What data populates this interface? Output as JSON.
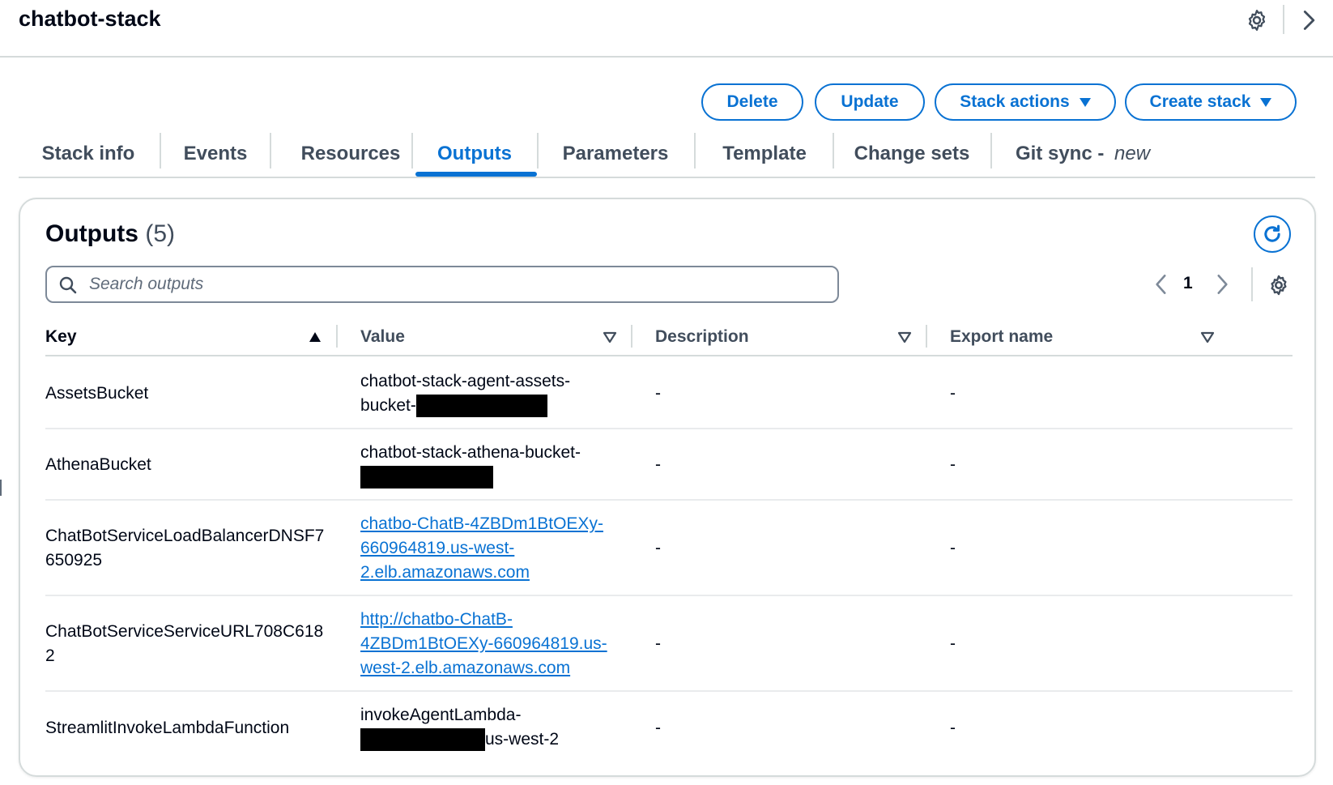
{
  "header": {
    "title": "chatbot-stack"
  },
  "actions": {
    "delete": "Delete",
    "update": "Update",
    "stack_actions": "Stack actions",
    "create_stack": "Create stack"
  },
  "tabs": [
    {
      "label": "Stack info"
    },
    {
      "label": "Events"
    },
    {
      "label": "Resources"
    },
    {
      "label": "Outputs"
    },
    {
      "label": "Parameters"
    },
    {
      "label": "Template"
    },
    {
      "label": "Change sets"
    },
    {
      "label": "Git sync - ",
      "badge": "new"
    }
  ],
  "active_tab": "Outputs",
  "outputs": {
    "title": "Outputs",
    "count": "(5)",
    "search_placeholder": "Search outputs",
    "page": "1",
    "columns": [
      "Key",
      "Value",
      "Description",
      "Export name"
    ],
    "rows": [
      {
        "key": [
          "AssetsBucket"
        ],
        "value": [
          "chatbot-stack-agent-assets-",
          "bucket-"
        ],
        "link": false,
        "description": "-",
        "export": "-"
      },
      {
        "key": [
          "AthenaBucket"
        ],
        "value": [
          "chatbot-stack-athena-bucket-",
          ""
        ],
        "link": false,
        "description": "-",
        "export": "-"
      },
      {
        "key": [
          "ChatBotServiceLoadBalancerDNSF7",
          "650925"
        ],
        "value": [
          "chatbo-ChatB-4ZBDm1BtOEXy-",
          "660964819.us-west-",
          "2.elb.amazonaws.com"
        ],
        "link": true,
        "description": "-",
        "export": "-"
      },
      {
        "key": [
          "ChatBotServiceServiceURL708C618",
          "2"
        ],
        "value": [
          "http://chatbo-ChatB-",
          "4ZBDm1BtOEXy-660964819.us-",
          "west-2.elb.amazonaws.com"
        ],
        "link": true,
        "description": "-",
        "export": "-"
      },
      {
        "key": [
          "StreamlitInvokeLambdaFunction"
        ],
        "value": [
          "invokeAgentLambda-",
          "us-west-2"
        ],
        "link": false,
        "description": "-",
        "export": "-"
      }
    ]
  },
  "colors": {
    "accent": "#0972d3",
    "text": "#000716",
    "muted": "#414d5c",
    "border": "#d5dbdb"
  }
}
